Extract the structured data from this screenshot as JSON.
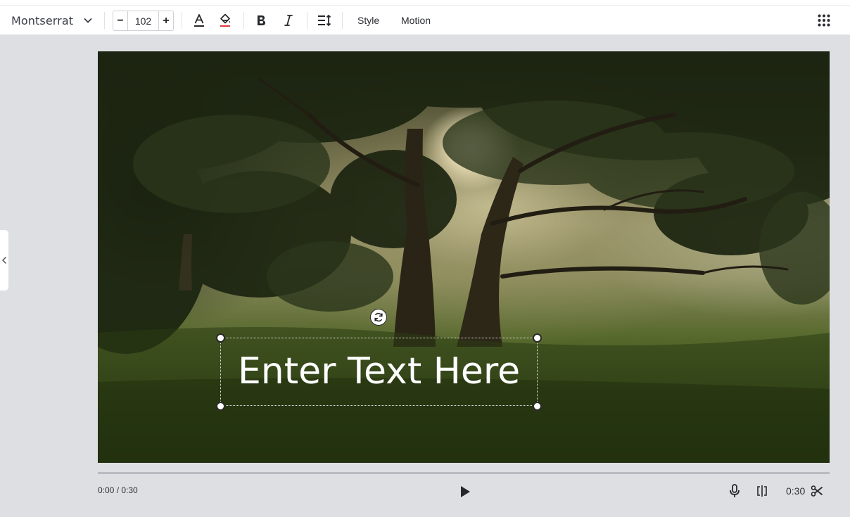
{
  "toolbar": {
    "font_name": "Montserrat",
    "font_size": "102",
    "decrement_label": "−",
    "increment_label": "+",
    "style_label": "Style",
    "motion_label": "Motion",
    "icons": [
      "chevron-down-icon",
      "text-color-icon",
      "fill-color-icon",
      "bold-icon",
      "italic-icon",
      "line-spacing-icon",
      "grid-menu-icon"
    ]
  },
  "canvas": {
    "text_content": "Enter Text Here"
  },
  "player": {
    "current_time": "0:00 / 0:30",
    "duration": "0:30",
    "icons": [
      "play-icon",
      "microphone-icon",
      "split-icon",
      "scissors-icon"
    ]
  },
  "colors": {
    "background": "#dedfe3",
    "toolbar": "#ffffff",
    "text": "#2b2d33",
    "fill_icon_underline": "#e0393e"
  }
}
